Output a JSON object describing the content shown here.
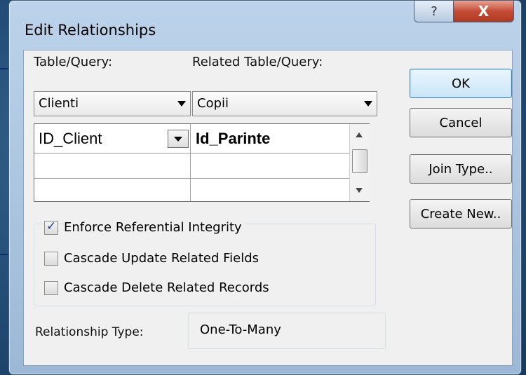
{
  "window": {
    "title": "Edit Relationships",
    "help_label": "?",
    "close_label": "X"
  },
  "labels": {
    "table_query": "Table/Query:",
    "related_table_query": "Related Table/Query:",
    "relationship_type": "Relationship Type:"
  },
  "combos": {
    "table": "Clienti",
    "related_table": "Copii"
  },
  "fields_grid": {
    "rows": [
      {
        "left": "ID_Client",
        "right": "Id_Parinte"
      },
      {
        "left": "",
        "right": ""
      },
      {
        "left": "",
        "right": ""
      }
    ]
  },
  "buttons": {
    "ok": "OK",
    "cancel": "Cancel",
    "join_type": "Join Type..",
    "create_new": "Create New.."
  },
  "options": {
    "enforce": {
      "label": "Enforce Referential Integrity",
      "checked": true
    },
    "cascade_update": {
      "label": "Cascade Update Related Fields",
      "checked": false
    },
    "cascade_delete": {
      "label": "Cascade Delete Related Records",
      "checked": false
    }
  },
  "relationship_type_value": "One-To-Many",
  "colors": {
    "close_button": "#c44c36",
    "dialog_frame": "#bcd3ea",
    "client_area": "#f0f0f0",
    "checkmark": "#1a3f8c"
  }
}
